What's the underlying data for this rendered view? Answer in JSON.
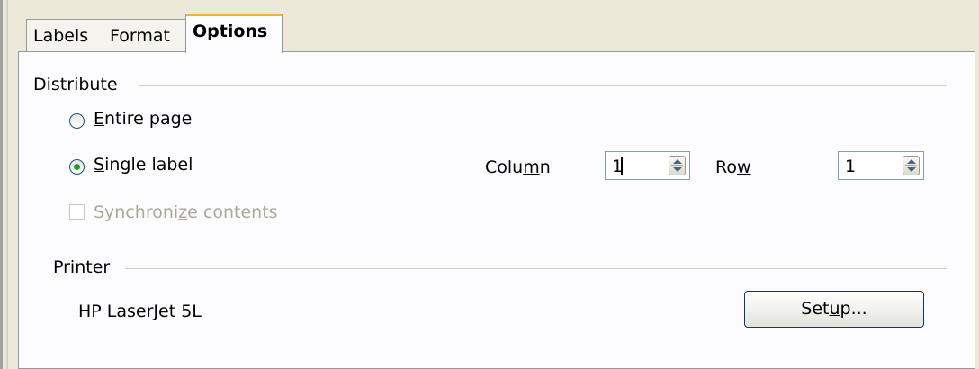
{
  "tabs": [
    {
      "label": "Labels",
      "active": false
    },
    {
      "label": "Format",
      "active": false
    },
    {
      "label": "Options",
      "active": true
    }
  ],
  "distribute": {
    "heading": "Distribute",
    "entire_page": {
      "pre": "",
      "mn": "E",
      "post": "ntire page",
      "selected": false
    },
    "single_label": {
      "pre": "",
      "mn": "S",
      "post": "ingle label",
      "selected": true
    },
    "synchronize": {
      "pre": "Synchroni",
      "mn": "z",
      "post": "e contents",
      "checked": false,
      "enabled": false
    },
    "column": {
      "pre": "Colu",
      "mn": "m",
      "post": "n",
      "value": "1"
    },
    "row": {
      "pre": "Ro",
      "mn": "w",
      "post": "",
      "value": "1"
    }
  },
  "printer": {
    "heading": "Printer",
    "name": "HP LaserJet 5L",
    "setup": {
      "pre": "Set",
      "mn": "u",
      "post": "p..."
    }
  },
  "colors": {
    "dialog_bg": "#ece9d8",
    "panel_bg": "#fcfcfe",
    "active_tab_accent": "#f7b03a",
    "radio_dot": "#21a121",
    "disabled_text": "#aca899"
  }
}
